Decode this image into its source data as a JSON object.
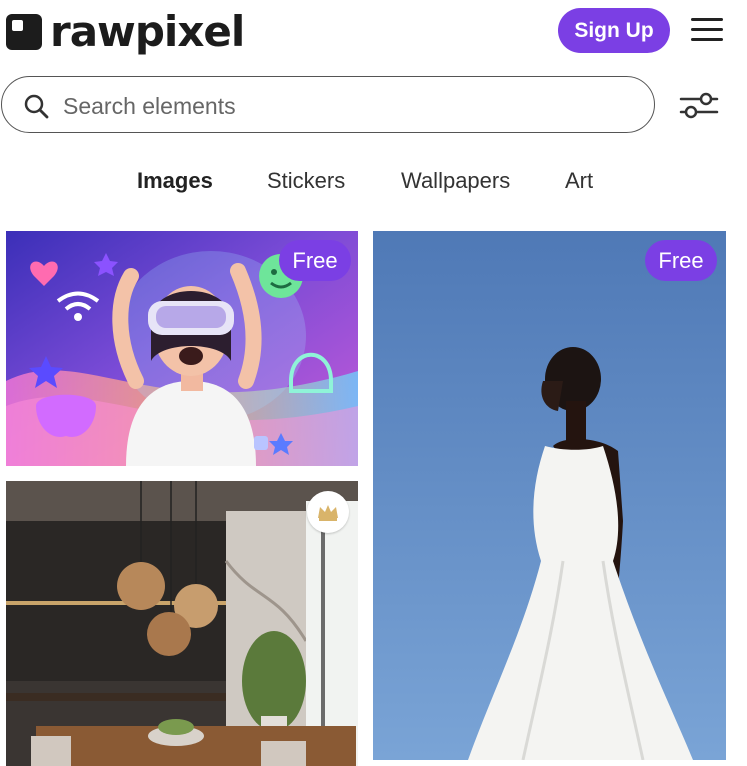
{
  "header": {
    "logo_text": "rawpixel",
    "signup_label": "Sign Up",
    "menu_icon": "hamburger-menu-icon"
  },
  "search": {
    "placeholder": "Search elements",
    "icon": "search-icon",
    "filter_icon": "filter-sliders-icon"
  },
  "tabs": [
    {
      "label": "Images",
      "active": true
    },
    {
      "label": "Stickers",
      "active": false
    },
    {
      "label": "Wallpapers",
      "active": false
    },
    {
      "label": "Art",
      "active": false
    }
  ],
  "images": [
    {
      "badge": "Free",
      "subject": "vr-headset-illustration"
    },
    {
      "badge": "Free",
      "subject": "woman-white-dress"
    },
    {
      "badge_icon": "crown-icon",
      "subject": "kitchen-interior"
    }
  ],
  "colors": {
    "accent": "#7b3fe4",
    "text": "#222222"
  }
}
